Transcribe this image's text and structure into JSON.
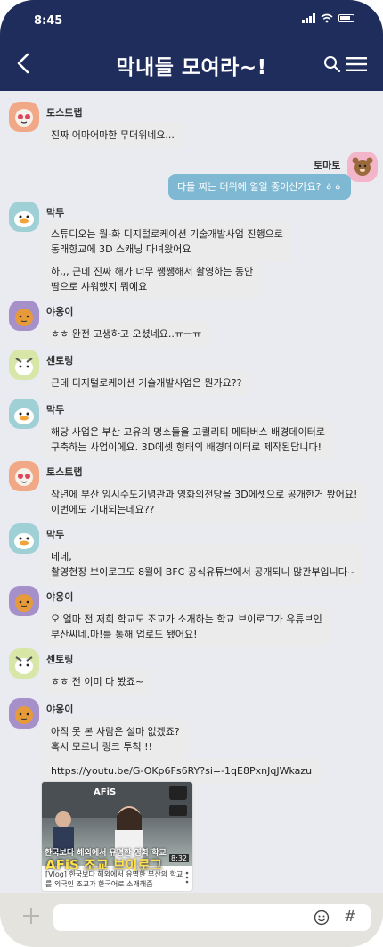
{
  "status": {
    "time": "8:45"
  },
  "header": {
    "title": "막내들 모여라~!"
  },
  "messages": {
    "m1": {
      "name": "토스트랩",
      "text": "진짜 어마어마한 무더위네요..."
    },
    "m2": {
      "name": "토마토",
      "text": "다들 찌는 더위에 열일 중이신가요? ㅎㅎ"
    },
    "m3": {
      "name": "막두",
      "text1": "스튜디오는 월-화 디지털로케이션 기술개발사업 진행으로\n동래향교에 3D 스캐닝 다녀왔어요",
      "text2": "하,,, 근데 진짜 해가 너무 쨍쨍해서 촬영하는 동안\n땀으로 샤워했지 뭐예요"
    },
    "m4": {
      "name": "야옹이",
      "text": "ㅎㅎ 완전 고생하고 오셨네요..ㅠㅡㅠ"
    },
    "m5": {
      "name": "센토링",
      "text": "근데 디지털로케이션 기술개발사업은 뭔가요??"
    },
    "m6": {
      "name": "막두",
      "text": "해당 사업은 부산 고유의 명소들을 고퀄리티 메타버스 배경데이터로\n구축하는 사업이에요. 3D에셋 형태의 배경데이터로 제작된답니다!"
    },
    "m7": {
      "name": "토스트랩",
      "text": "작년에 부산 임시수도기념관과 영화의전당을 3D에셋으로 공개한거 봤어요!\n이번에도 기대되는데요??"
    },
    "m8": {
      "name": "막두",
      "text": "네네,\n촬영현장 브이로그도 8월에 BFC 공식유튜브에서 공개되니 많관부입니다~"
    },
    "m9": {
      "name": "야옹이",
      "text": "오 얼마 전 저희 학교도 조교가 소개하는 학교 브이로그가 유튜브인\n부산씨네,마!를 통해 업로드 됐어요!"
    },
    "m10": {
      "name": "센토링",
      "text": "ㅎㅎ 전 이미 다 봤죠~"
    },
    "m11": {
      "name": "야옹이",
      "text1": "아직 못 본 사람은 설마 없겠죠?\n혹시 모르니 링크 투척 !!",
      "link": "https://youtu.be/G-OKp6Fs6RY?si=-1qE8PxnJqJWkazu"
    }
  },
  "video": {
    "brand": "AFiS",
    "caption": "한국보다 해외에서 유명한 영화 학교",
    "big": "AFiS 조교 브이로그",
    "duration": "8:32",
    "title": "[Vlog] 한국보다 해외에서 유명한 부산의 학교를 외국인 조교가 한국어로 소개해줌"
  }
}
